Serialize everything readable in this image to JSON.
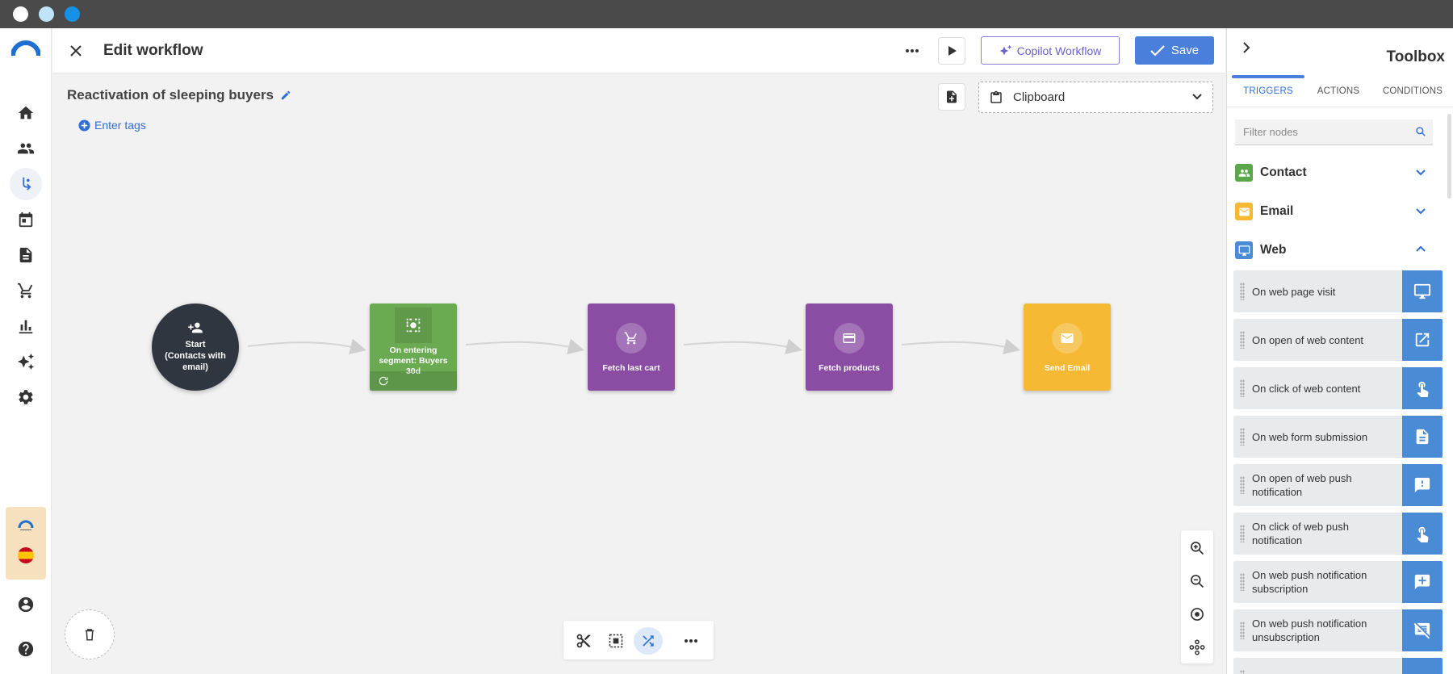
{
  "header": {
    "title": "Edit workflow",
    "copilot_label": "Copilot Workflow",
    "save_label": "Save"
  },
  "workflow": {
    "name": "Reactivation of sleeping buyers",
    "tags_placeholder": "Enter tags",
    "clipboard_label": "Clipboard"
  },
  "nodes": [
    {
      "label": "Start\n(Contacts with email)",
      "color": "#2f3640"
    },
    {
      "label": "On entering segment: Buyers 30d",
      "color": "#6aab52"
    },
    {
      "label": "Fetch last cart",
      "color": "#8a4da3"
    },
    {
      "label": "Fetch products",
      "color": "#8a4da3"
    },
    {
      "label": "Send Email",
      "color": "#f5b933"
    }
  ],
  "toolbox": {
    "title": "Toolbox",
    "tabs": [
      "TRIGGERS",
      "ACTIONS",
      "CONDITIONS"
    ],
    "filter_placeholder": "Filter nodes",
    "categories": [
      {
        "label": "Contact",
        "color": "#5aa84a"
      },
      {
        "label": "Email",
        "color": "#f5b933"
      },
      {
        "label": "Web",
        "color": "#4a8bd6"
      }
    ],
    "items": [
      "On web page visit",
      "On open of web content",
      "On click of web content",
      "On web form submission",
      "On open of web push notification",
      "On click of web push notification",
      "On web push notification subscription",
      "On web push notification unsubscription"
    ]
  },
  "colors": {
    "accent": "#4a7fdb",
    "copilot": "#6b62c8"
  }
}
